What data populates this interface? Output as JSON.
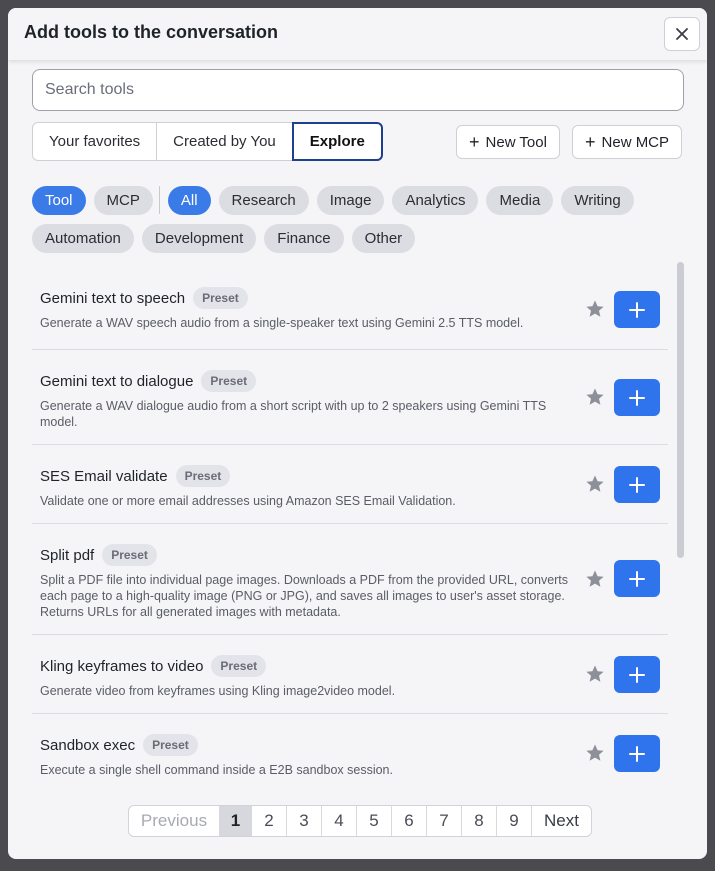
{
  "dialog": {
    "title": "Add tools to the conversation"
  },
  "search": {
    "placeholder": "Search tools"
  },
  "tabs": [
    "Your favorites",
    "Created by You",
    "Explore"
  ],
  "actions": {
    "new_tool": "New Tool",
    "new_mcp": "New MCP"
  },
  "type_chips": [
    "Tool",
    "MCP"
  ],
  "category_chips": [
    "All",
    "Research",
    "Image",
    "Analytics",
    "Media",
    "Writing"
  ],
  "category_chips_row2": [
    "Automation",
    "Development",
    "Finance",
    "Other"
  ],
  "badge_label": "Preset",
  "tools": [
    {
      "name": "Gemini text to speech",
      "desc": "Generate a WAV speech audio from a single-speaker text using Gemini 2.5 TTS model."
    },
    {
      "name": "Gemini text to dialogue",
      "desc": "Generate a WAV dialogue audio from a short script with up to 2 speakers using Gemini TTS model."
    },
    {
      "name": "SES Email validate",
      "desc": "Validate one or more email addresses using Amazon SES Email Validation."
    },
    {
      "name": "Split pdf",
      "desc": "Split a PDF file into individual page images. Downloads a PDF from the provided URL, converts each page to a high-quality image (PNG or JPG), and saves all images to user's asset storage. Returns URLs for all generated images with metadata."
    },
    {
      "name": "Kling keyframes to video",
      "desc": "Generate video from keyframes using Kling image2video model."
    },
    {
      "name": "Sandbox exec",
      "desc": "Execute a single shell command inside a E2B sandbox session."
    }
  ],
  "pagination": {
    "previous": "Previous",
    "pages": [
      "1",
      "2",
      "3",
      "4",
      "5",
      "6",
      "7",
      "8",
      "9"
    ],
    "current": "1",
    "next": "Next"
  },
  "colors": {
    "accent": "#3b7be8",
    "add_button": "#2f74ec",
    "chip_bg": "#dcdce3"
  }
}
